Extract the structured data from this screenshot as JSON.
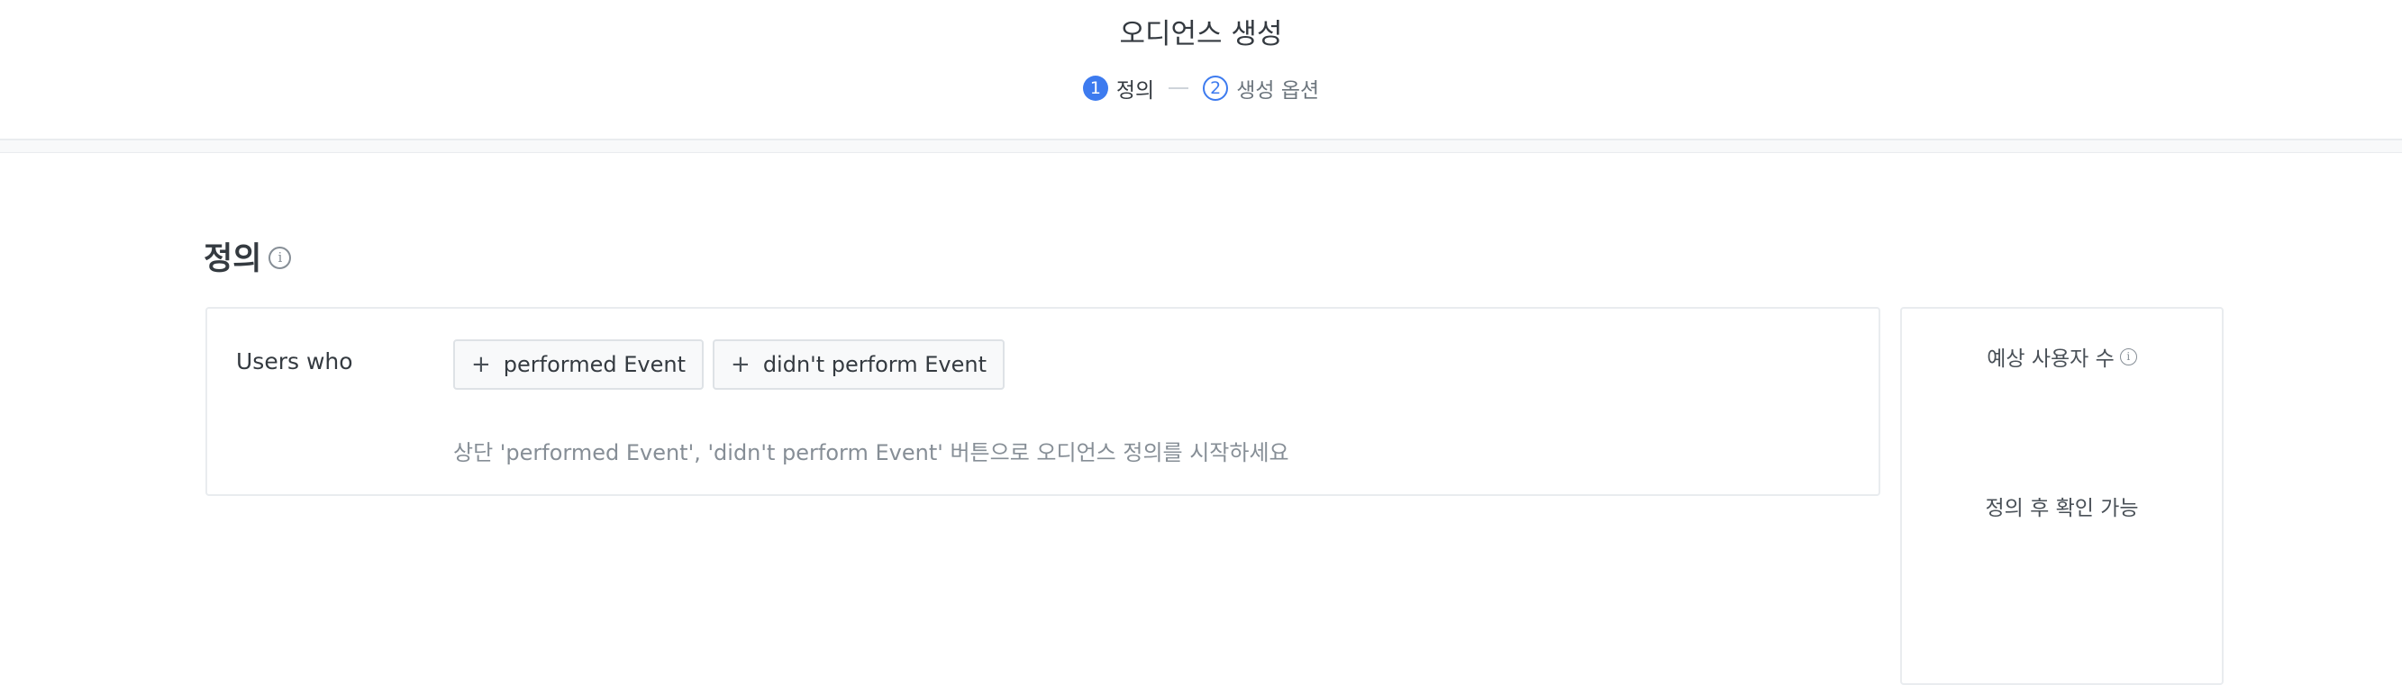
{
  "header": {
    "title": "오디언스 생성",
    "steps": [
      {
        "number": "1",
        "label": "정의",
        "state": "active"
      },
      {
        "number": "2",
        "label": "생성 옵션",
        "state": "inactive"
      }
    ]
  },
  "definition": {
    "section_title": "정의",
    "users_who_label": "Users who",
    "buttons": {
      "performed": "performed Event",
      "did_not_perform": "didn't perform Event"
    },
    "plus_symbol": "+",
    "hint": "상단 'performed Event', 'didn't perform Event' 버튼으로 오디언스 정의를 시작하세요"
  },
  "estimate": {
    "title": "예상 사용자 수",
    "value": "정의 후 확인 가능"
  },
  "icons": {
    "info": "info-icon",
    "plus": "plus-icon"
  },
  "colors": {
    "accent": "#3d7bef",
    "muted_text": "#868e96",
    "border": "#e9ecef"
  }
}
